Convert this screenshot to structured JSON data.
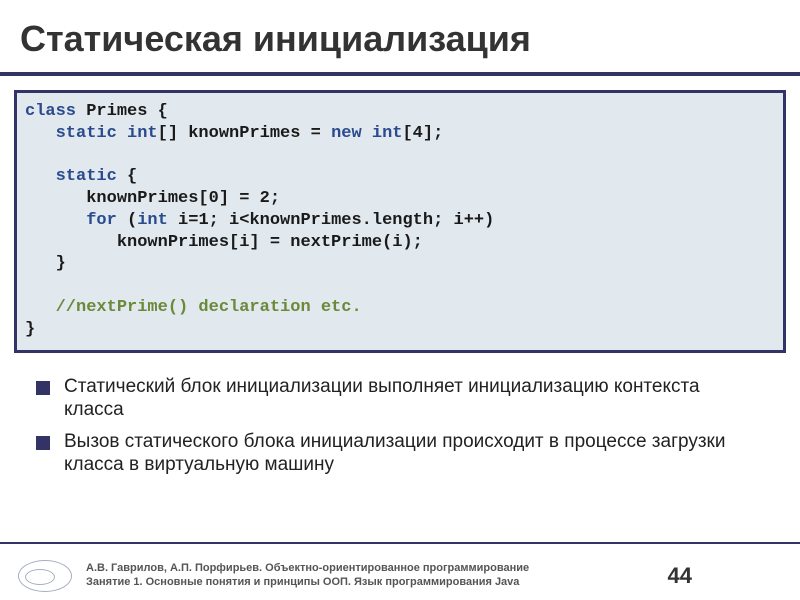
{
  "title": "Статическая инициализация",
  "code": {
    "l1a": "class",
    "l1b": " Primes {",
    "l2a": "   static int",
    "l2b": "[] knownPrimes = ",
    "l2c": "new int",
    "l2d": "[4];",
    "l3": "",
    "l4a": "   static",
    "l4b": " {",
    "l5": "      knownPrimes[0] = 2;",
    "l6a": "      for",
    "l6b": " (",
    "l6c": "int",
    "l6d": " i=1; i<knownPrimes.length; i++)",
    "l7": "         knownPrimes[i] = nextPrime(i);",
    "l8": "   }",
    "l9": "",
    "l10": "   //nextPrime() declaration etc.",
    "l11": "}"
  },
  "bullets": [
    "Статический блок инициализации выполняет инициализацию контекста класса",
    "Вызов статического блока инициализации происходит в процессе загрузки класса в виртуальную машину"
  ],
  "footer": {
    "line1": "А.В. Гаврилов, А.П. Порфирьев. Объектно-ориентированное программирование",
    "line2": "Занятие 1. Основные понятия и принципы ООП. Язык программирования Java"
  },
  "page_number": "44"
}
